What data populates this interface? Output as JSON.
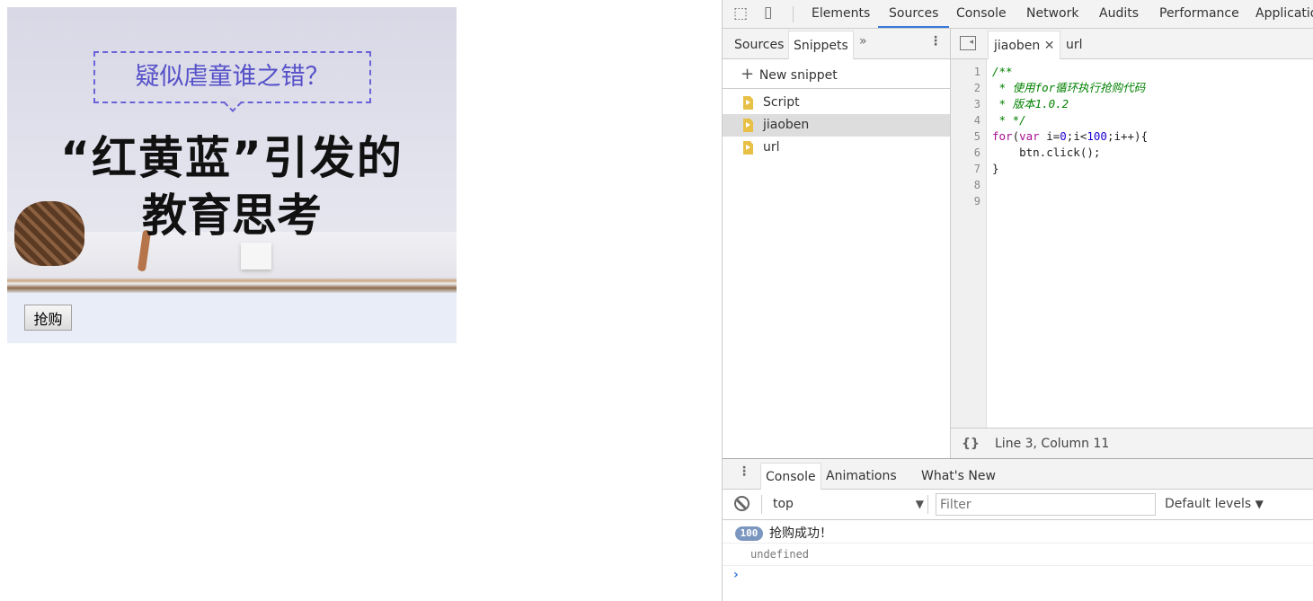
{
  "page": {
    "banner": {
      "bubble_text": "疑似虐童谁之错？",
      "headline_line1": "“红黄蓝”引发的",
      "headline_line2": "教育思考"
    },
    "buy_button": "抢购"
  },
  "devtools": {
    "main_tabs": [
      "Elements",
      "Sources",
      "Console",
      "Network",
      "Audits",
      "Performance",
      "Applicatio"
    ],
    "active_main_tab": "Sources",
    "nav_tabs": [
      "Sources",
      "Snippets"
    ],
    "active_nav_tab": "Snippets",
    "new_snippet": "New snippet",
    "snippets": [
      {
        "name": "Script"
      },
      {
        "name": "jiaoben",
        "selected": true
      },
      {
        "name": "url"
      }
    ],
    "editor_tabs": [
      {
        "name": "jiaoben",
        "closable": true,
        "active": true
      },
      {
        "name": "url"
      }
    ],
    "code_lines": [
      "/**",
      " * 使用for循环执行抢购代码",
      " * 版本1.0.2",
      " * */",
      "for(var i=0;i<100;i++){",
      "    btn.click();",
      "}",
      "",
      ""
    ],
    "status": "Line 3, Column 11",
    "drawer_tabs": [
      "Console",
      "Animations",
      "What's New"
    ],
    "console": {
      "context": "top",
      "filter_placeholder": "Filter",
      "levels": "Default levels",
      "messages": [
        {
          "count": "100",
          "text": "抢购成功！"
        },
        {
          "text": "undefined"
        }
      ]
    }
  }
}
